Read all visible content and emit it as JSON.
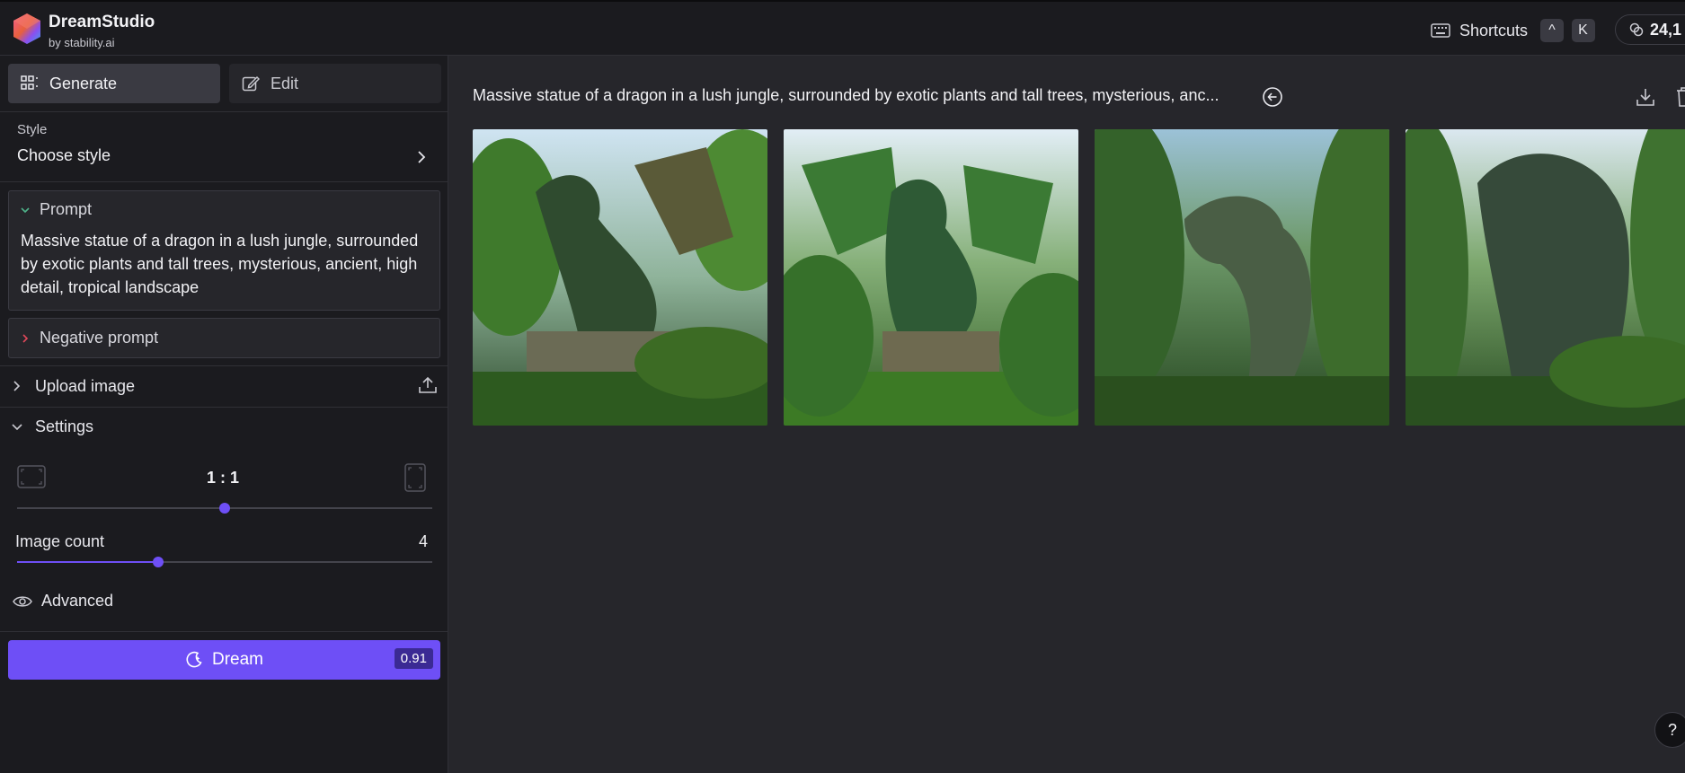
{
  "header": {
    "app_name": "DreamStudio",
    "app_sub": "by stability.ai",
    "shortcuts_label": "Shortcuts",
    "shortcut_keys": [
      "^",
      "K"
    ],
    "credits": "24,1"
  },
  "sidebar": {
    "tabs": [
      {
        "label": "Generate",
        "icon": "grid-icon",
        "active": true
      },
      {
        "label": "Edit",
        "icon": "edit-icon",
        "active": false
      }
    ],
    "style": {
      "label": "Style",
      "value": "Choose style"
    },
    "prompt": {
      "label": "Prompt",
      "text": "Massive statue of a dragon in a lush jungle, surrounded by exotic plants and tall trees, mysterious, ancient, high detail, tropical landscape"
    },
    "negative_prompt": {
      "label": "Negative prompt"
    },
    "upload": {
      "label": "Upload image"
    },
    "settings": {
      "label": "Settings",
      "aspect_ratio": {
        "value": "1 : 1",
        "slider_fraction": 0.5
      },
      "image_count": {
        "label": "Image count",
        "value": "4",
        "slider_fraction": 0.34
      }
    },
    "advanced": {
      "label": "Advanced"
    },
    "dream_button": {
      "label": "Dream",
      "cost": "0.91"
    }
  },
  "main": {
    "result_title": "Massive statue of a dragon in a lush jungle, surrounded by exotic plants and tall trees, mysterious, anc...",
    "images_count": 4,
    "help_label": "?"
  },
  "colors": {
    "accent": "#6e4ff6",
    "background": "#26262b",
    "panel": "#1b1b1f"
  }
}
